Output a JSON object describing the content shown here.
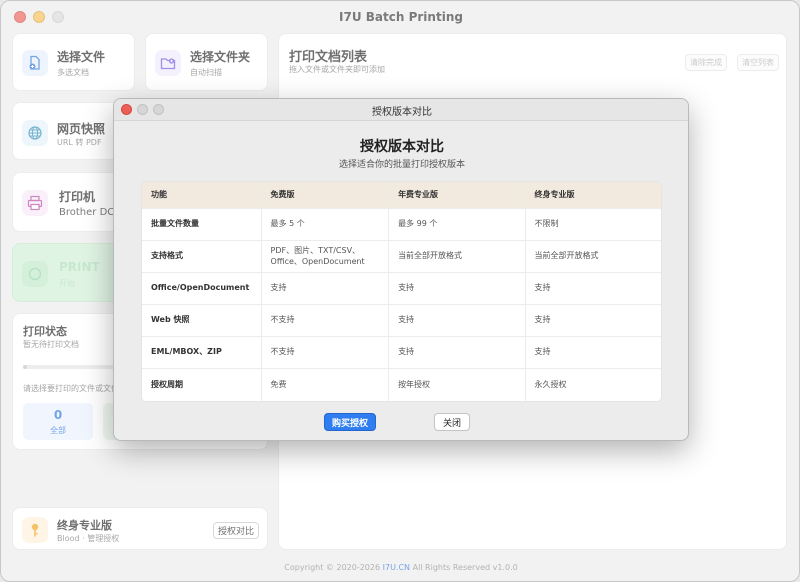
{
  "window": {
    "title": "I7U Batch Printing"
  },
  "cards": {
    "select_file": {
      "title": "选择文件",
      "sub": "多选文档"
    },
    "select_folder": {
      "title": "选择文件夹",
      "sub": "自动扫描"
    },
    "web_snapshot": {
      "title": "网页快照",
      "sub": "URL 转 PDF"
    },
    "printer": {
      "title": "打印机",
      "value": "Brother DCP"
    },
    "green": {
      "title": "PRINT",
      "sub": "开始"
    }
  },
  "status": {
    "title": "打印状态",
    "sub": "暂无待打印文档",
    "hint": "请选择要打印的文件或文件夹",
    "count": "0",
    "count_label": "全部"
  },
  "license": {
    "title": "终身专业版",
    "sub": "Blood · 管理授权",
    "compare_button": "授权对比"
  },
  "doc_list": {
    "title": "打印文档列表",
    "sub": "拖入文件或文件夹即可添加",
    "clear_done": "清除完成",
    "clear_list": "清空列表"
  },
  "footer": {
    "prefix": "Copyright © 2020-2026 ",
    "link": "I7U.CN",
    "suffix": " All Rights Reserved v1.0.0"
  },
  "dialog": {
    "window_title": "授权版本对比",
    "heading": "授权版本对比",
    "subheading": "选择适合你的批量打印授权版本",
    "buy_button": "购买授权",
    "close_button": "关闭",
    "table": {
      "headers": [
        "功能",
        "免费版",
        "年费专业版",
        "终身专业版"
      ],
      "rows": [
        [
          "批量文件数量",
          "最多 5 个",
          "最多 99 个",
          "不限制"
        ],
        [
          "支持格式",
          "PDF、图片、TXT/CSV、Office、OpenDocument",
          "当前全部开放格式",
          "当前全部开放格式"
        ],
        [
          "Office/OpenDocument",
          "支持",
          "支持",
          "支持"
        ],
        [
          "Web 快照",
          "不支持",
          "支持",
          "支持"
        ],
        [
          "EML/MBOX、ZIP",
          "不支持",
          "支持",
          "支持"
        ],
        [
          "授权周期",
          "免费",
          "按年授权",
          "永久授权"
        ]
      ]
    }
  },
  "colors": {
    "accent": "#2f7df0",
    "header_bg": "#f2e9df",
    "green_card": "#cfeed6",
    "status_tile": "#eaf2fd"
  }
}
